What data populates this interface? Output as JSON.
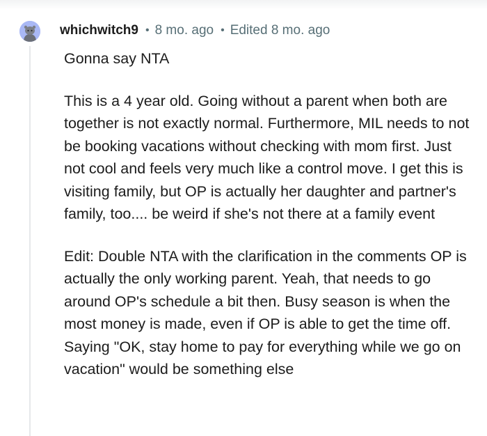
{
  "comment": {
    "author": "whichwitch9",
    "separator": "•",
    "time": "8 mo. ago",
    "edited": "Edited 8 mo. ago",
    "avatar_icon": "snoo-avatar-icon",
    "avatar_color": "#a9b8f5",
    "paragraphs": [
      "Gonna say NTA",
      "This is a 4 year old. Going without a parent when both are together is not exactly normal. Furthermore, MIL needs to not be booking vacations without checking with mom first. Just not cool and feels very much like a control move. I get this is visiting family, but OP is actually her daughter and partner's family, too.... be weird if she's not there at a family event",
      "Edit: Double NTA with the clarification in the comments OP is actually the only working parent. Yeah, that needs to go around OP's schedule a bit then. Busy season is when the most money is made, even if OP is able to get the time off. Saying \"OK, stay home to pay for everything while we go on vacation\" would be something else"
    ]
  }
}
